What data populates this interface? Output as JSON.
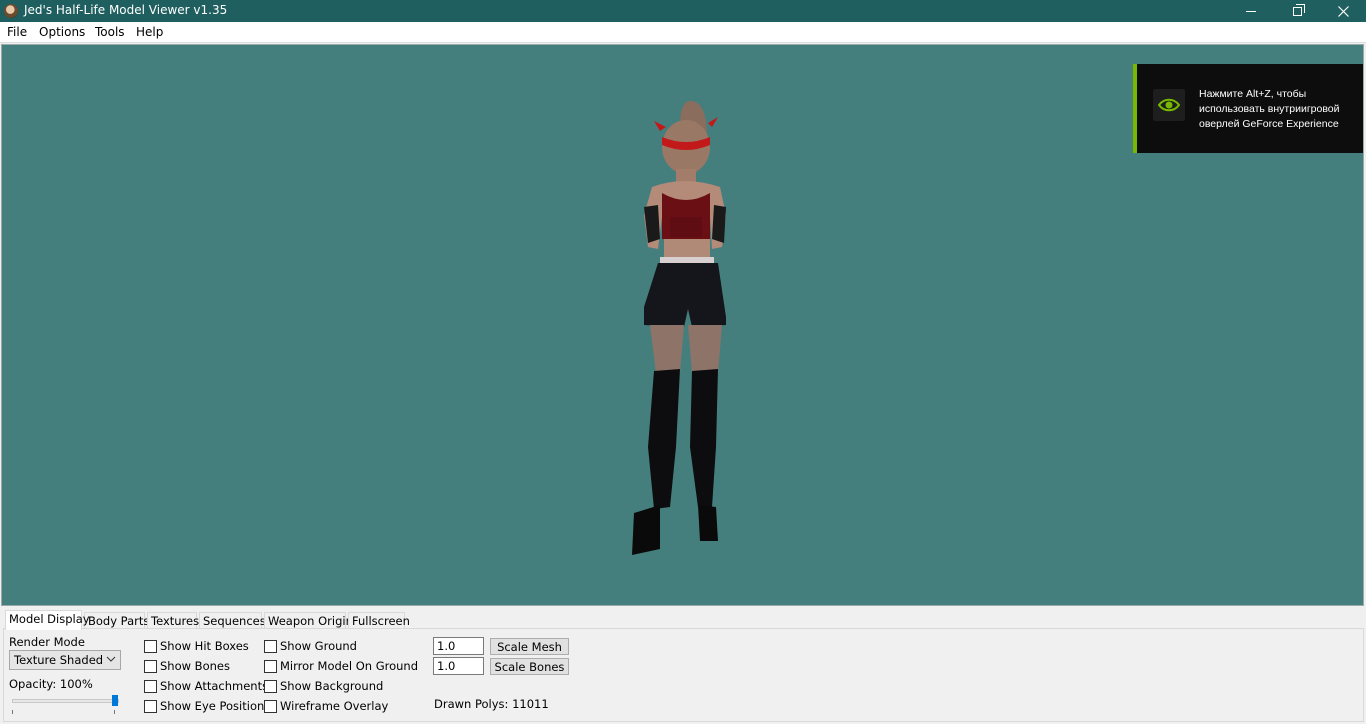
{
  "window": {
    "title": "Jed's Half-Life Model Viewer v1.35",
    "icon": "app-icon",
    "controls": [
      "minimize-icon",
      "restore-icon",
      "close-icon"
    ]
  },
  "menu": {
    "file": "File",
    "options": "Options",
    "tools": "Tools",
    "help": "Help"
  },
  "viewport": {
    "background_color": "#447f7e"
  },
  "overlay": {
    "line1": "Нажмите Alt+Z, чтобы",
    "line2": "использовать внутриигровой",
    "line3": "оверлей GeForce Experience",
    "accent_color": "#76b900"
  },
  "tabs": {
    "model_display": "Model Display",
    "body_parts": "Body Parts",
    "textures": "Textures",
    "sequences": "Sequences",
    "weapon_origin": "Weapon Origin",
    "fullscreen": "Fullscreen"
  },
  "model_display": {
    "render_mode_label": "Render Mode",
    "render_mode_value": "Texture Shaded",
    "opacity_label": "Opacity: 100%",
    "opacity_value": 1.0,
    "checkboxes": {
      "hit_boxes": "Show Hit Boxes",
      "bones": "Show Bones",
      "attachments": "Show Attachments",
      "eye_position": "Show Eye Position",
      "ground": "Show Ground",
      "mirror": "Mirror Model On Ground",
      "background": "Show Background",
      "wireframe": "Wireframe Overlay"
    },
    "scale_mesh_value": "1.0",
    "scale_mesh_button": "Scale Mesh",
    "scale_bones_value": "1.0",
    "scale_bones_button": "Scale Bones",
    "drawn_polys": "Drawn Polys: 11011"
  }
}
